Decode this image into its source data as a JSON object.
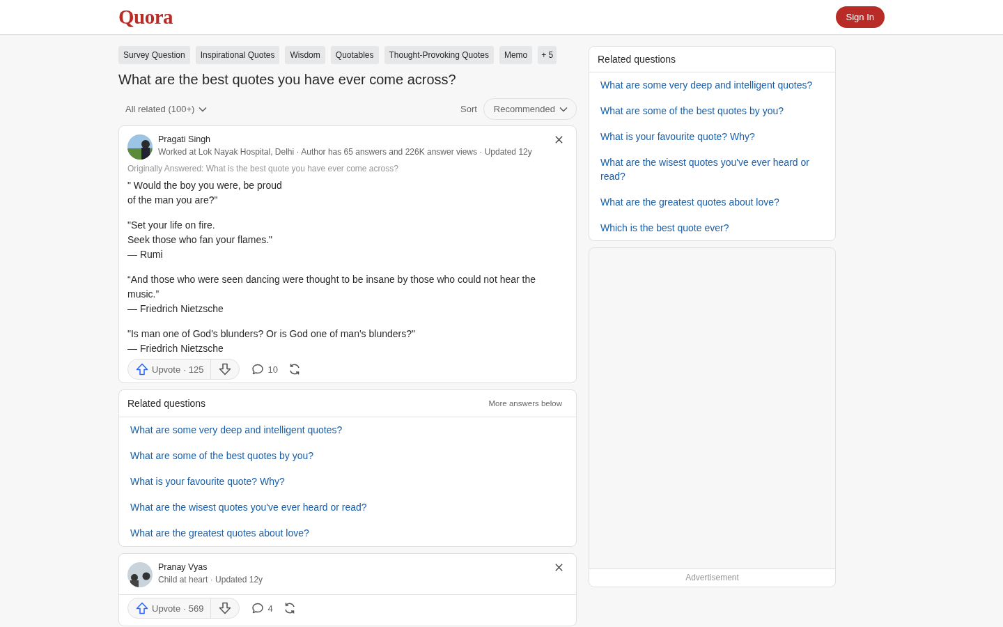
{
  "header": {
    "logo": "Quora",
    "sign_in": "Sign In"
  },
  "topics": [
    "Survey Question",
    "Inspirational Quotes",
    "Wisdom",
    "Quotables",
    "Thought-Provoking Quotes",
    "Memo"
  ],
  "more_topics": "+ 5",
  "question": "What are the best quotes you have ever come across?",
  "filter": {
    "label": "All related (100+)",
    "sort_label": "Sort",
    "sort_value": "Recommended"
  },
  "answers": [
    {
      "author": "Pragati Singh",
      "credential": "Worked at Lok Nayak Hospital, Delhi · Author has 65 answers and 226K answer views · Updated 12y",
      "originally": "Originally Answered: What is the best quote you have ever come across?",
      "paragraphs": [
        [
          "\" Would the boy you were, be proud",
          "of the man you are?\""
        ],
        [
          "\"Set your life on fire.",
          "Seek those who fan your flames.\"",
          "— Rumi"
        ],
        [
          "“And those who were seen dancing were thought to be insane by those who could not hear the music.”",
          "— Friedrich Nietzsche"
        ],
        [
          "\"Is man one of God's blunders? Or is God one of man's blunders?\"",
          "— Friedrich Nietzsche"
        ]
      ],
      "upvote": "Upvote · 125",
      "comments": "10"
    },
    {
      "author": "Pranay Vyas",
      "credential": "Child at heart · Updated 12y",
      "upvote": "Upvote · 569",
      "comments": "4"
    }
  ],
  "inline_related": {
    "title": "Related questions",
    "note": "More answers below",
    "items": [
      "What are some very deep and intelligent quotes?",
      "What are some of the best quotes by you?",
      "What is your favourite quote? Why?",
      "What are the wisest quotes you've ever heard or read?",
      "What are the greatest quotes about love?"
    ]
  },
  "sidebar_related": {
    "title": "Related questions",
    "items": [
      "What are some very deep and intelligent quotes?",
      "What are some of the best quotes by you?",
      "What is your favourite quote? Why?",
      "What are the wisest quotes you've ever heard or read?",
      "What are the greatest quotes about love?",
      "Which is the best quote ever?"
    ]
  },
  "ad": {
    "label": "Advertisement"
  }
}
